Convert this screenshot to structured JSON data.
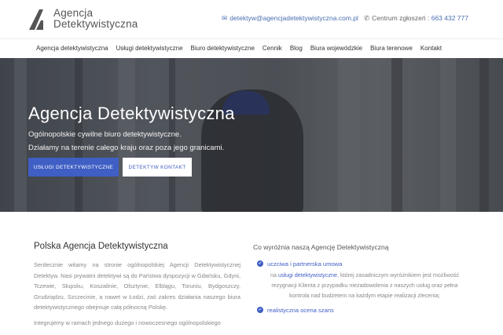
{
  "brand": {
    "line1": "Agencja",
    "line2": "Detektywistyczna",
    "logo_icon": "triangle-a-logo"
  },
  "header": {
    "email_icon": "envelope-icon",
    "email": "detektyw@agencjadetektywistyczna.com.pl",
    "phone_icon": "phone-icon",
    "phone_label": "Centrum zgłoszeń :",
    "phone": "663 432 777"
  },
  "nav": {
    "items": [
      "Agencja detektywistyczna",
      "Usługi detektywistyczne",
      "Biuro detektywistyczne",
      "Cennik",
      "Blog",
      "Biura wojewódzkie",
      "Biura terenowe",
      "Kontakt"
    ]
  },
  "hero": {
    "title": "Agencja Detektywistyczna",
    "sub1": "Ogólnopolskie cywilne biuro detektywistyczne.",
    "sub2": "Działamy na terenie całego kraju oraz poza jego granicami.",
    "btn_primary": "USŁUGI DETEKTYWISTYCZNE",
    "btn_secondary": "DETEKTYW KONTAKT"
  },
  "main": {
    "left_title": "Polska Agencja Detektywistyczna",
    "para1": "Serdecznie witamy na stronie ogólnopolskiej Agencji Detektywistycznej Detektyw. Nasi prywatni detektywi są do Państwa dyspozycji w Gdańsku, Gdyni, Tczewie, Słupsku, Koszalinie, Olsztynie, Elblągu, Toruniu, Bydgoszczy, Grudziądzu, Szczecinie, a nawet w Łodzi, zaś zakres działania naszego biura detektywistycznego obejmuje całą północną Polskę.",
    "para2": "Integrujemy w ramach jednego dużego i nowoczesnego ogólnopolskiego",
    "right_title": "Co wyróżnia naszą Agencję Detektywistyczną",
    "features": [
      {
        "title": "uczciwa i partnerska umowa",
        "desc_pre": "na ",
        "desc_link": "usługi detektywistyczne",
        "desc_post": ", której zasadniczym wyróżnikiem jest możliwość rezygnacji Klienta z przypadku niezadowolenia z naszych usług oraz pełna kontrola nad budżetem na każdym etapie realizacji zlecenia;"
      },
      {
        "title": "realistyczna ocena szans",
        "desc_pre": "",
        "desc_link": "",
        "desc_post": ""
      }
    ],
    "bullet_icon": "check-circle-icon"
  },
  "colors": {
    "accent": "#3f5fc4",
    "link": "#4a6fb0"
  }
}
